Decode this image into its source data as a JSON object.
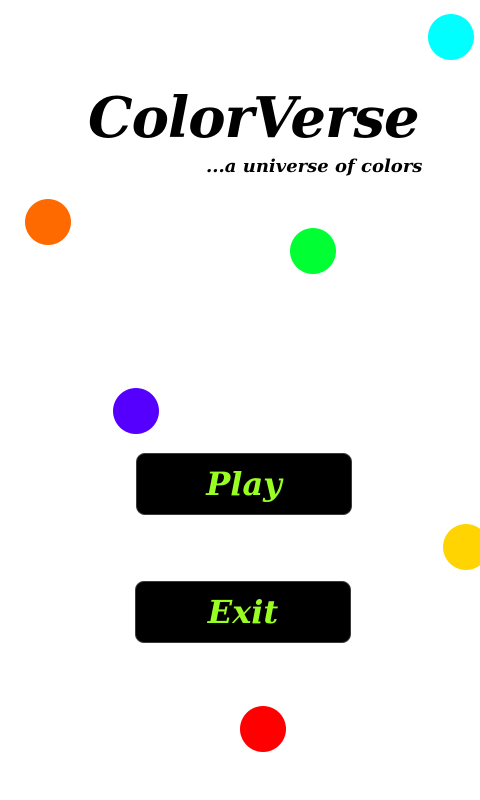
{
  "app": {
    "title": "ColorVerse",
    "tagline": "...a universe of colors"
  },
  "menu": {
    "play_label": "Play",
    "exit_label": "Exit"
  },
  "colors": {
    "background": "#ffffff",
    "text": "#000000",
    "button_bg": "#000000",
    "button_text": "#99ff22"
  },
  "dots": [
    {
      "name": "cyan-dot",
      "color": "#00ffff"
    },
    {
      "name": "orange-dot",
      "color": "#ff6a00"
    },
    {
      "name": "green-dot",
      "color": "#00ff33"
    },
    {
      "name": "purple-dot",
      "color": "#5500ff"
    },
    {
      "name": "yellow-dot",
      "color": "#ffd400"
    },
    {
      "name": "red-dot",
      "color": "#ff0000"
    }
  ]
}
